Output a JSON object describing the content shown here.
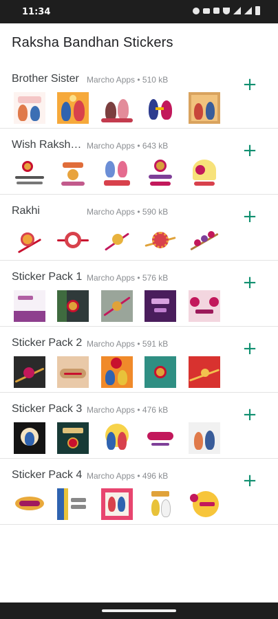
{
  "status_bar": {
    "time": "11:34"
  },
  "app": {
    "title": "Raksha Bandhan Stickers"
  },
  "packs": [
    {
      "name": "Brother Sister",
      "publisher": "Marcho Apps",
      "size": "510 kB",
      "add_icon": "plus-icon"
    },
    {
      "name": "Wish Raksh…",
      "publisher": "Marcho Apps",
      "size": "643 kB",
      "add_icon": "plus-icon"
    },
    {
      "name": "Rakhi",
      "publisher": "Marcho Apps",
      "size": "590 kB",
      "add_icon": "plus-icon"
    },
    {
      "name": "Sticker Pack 1",
      "publisher": "Marcho Apps",
      "size": "576 kB",
      "add_icon": "plus-icon"
    },
    {
      "name": "Sticker Pack 2",
      "publisher": "Marcho Apps",
      "size": "591 kB",
      "add_icon": "plus-icon"
    },
    {
      "name": "Sticker Pack 3",
      "publisher": "Marcho Apps",
      "size": "476 kB",
      "add_icon": "plus-icon"
    },
    {
      "name": "Sticker Pack 4",
      "publisher": "Marcho Apps",
      "size": "496 kB",
      "add_icon": "plus-icon"
    }
  ],
  "colors": {
    "accent": "#0f8f6f",
    "status_bar": "#1e1e1e",
    "divider": "#e3e3e3"
  }
}
